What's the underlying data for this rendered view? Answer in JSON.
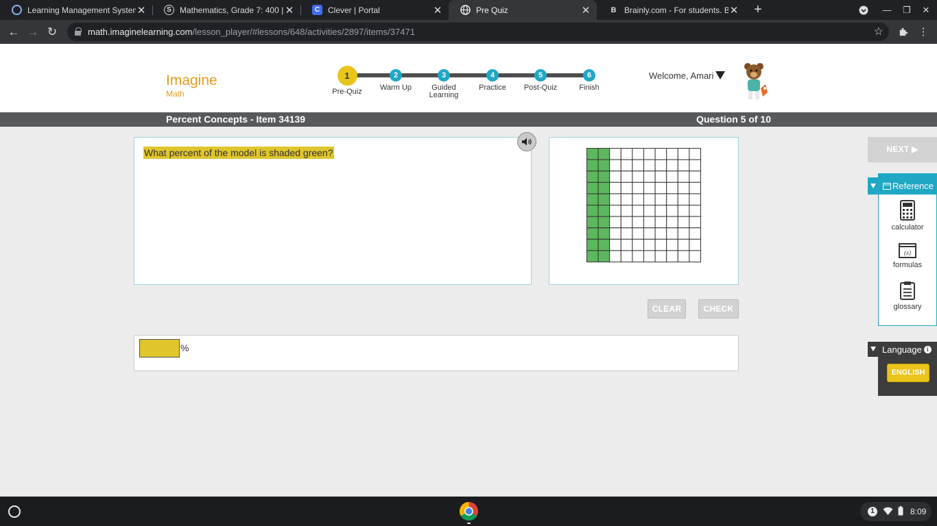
{
  "browser": {
    "tabs": [
      {
        "title": "Learning Management System |",
        "favicon": "circle-o-icon",
        "active": false
      },
      {
        "title": "Mathematics, Grade 7: 400 | Sch",
        "favicon": "schoology-icon",
        "active": false
      },
      {
        "title": "Clever | Portal",
        "favicon": "clever-icon",
        "active": false
      },
      {
        "title": "Pre Quiz",
        "favicon": "globe-icon",
        "active": true
      },
      {
        "title": "Brainly.com - For students. By st",
        "favicon": "brainly-icon",
        "active": false
      }
    ],
    "url_host": "math.imaginelearning.com",
    "url_path": "/lesson_player/#lessons/648/activities/2897/items/37471"
  },
  "app": {
    "logo_line1": "Imagine",
    "logo_line2": "Math",
    "steps": [
      {
        "num": "1",
        "label": "Pre-Quiz",
        "current": true
      },
      {
        "num": "2",
        "label": "Warm Up",
        "current": false
      },
      {
        "num": "3",
        "label": "Guided Learning",
        "current": false
      },
      {
        "num": "4",
        "label": "Practice",
        "current": false
      },
      {
        "num": "5",
        "label": "Post-Quiz",
        "current": false
      },
      {
        "num": "6",
        "label": "Finish",
        "current": false
      }
    ],
    "welcome": "Welcome, Amari"
  },
  "itembar": {
    "title": "Percent Concepts - Item 34139",
    "progress": "Question 5 of 10"
  },
  "question": {
    "prompt": "What percent of the model is shaded green?",
    "model": {
      "rows": 10,
      "cols": 10,
      "shaded_cols": 2,
      "shade_color": "#5cb85c"
    }
  },
  "actions": {
    "clear": "CLEAR",
    "check": "CHECK",
    "next": "NEXT ▶"
  },
  "answer": {
    "value": "",
    "unit": "%"
  },
  "reference": {
    "title": "Reference",
    "tools": [
      {
        "label": "calculator",
        "icon": "calculator-icon"
      },
      {
        "label": "formulas",
        "icon": "formulas-icon"
      },
      {
        "label": "glossary",
        "icon": "glossary-icon"
      }
    ]
  },
  "language": {
    "title": "Language",
    "current": "ENGLISH"
  },
  "system": {
    "notification_count": "1",
    "time": "8:09"
  },
  "colors": {
    "accent_teal": "#20a7c4",
    "highlight_yellow": "#e0c52c",
    "logo_orange": "#e89a1f",
    "current_step": "#e9c41b"
  }
}
